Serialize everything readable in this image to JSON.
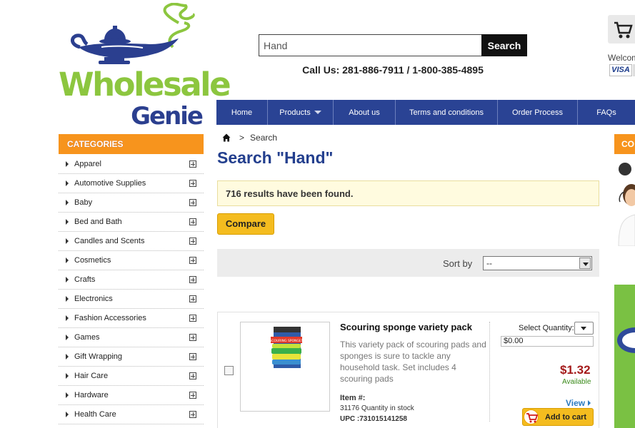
{
  "logo": {
    "line1": "Wholesale",
    "line2": "Genie"
  },
  "search": {
    "value": "Hand",
    "button_label": "Search"
  },
  "callus": "Call Us: 281-886-7911 / 1-800-385-4895",
  "header_right": {
    "welcome": "Welcom",
    "card": "VISA"
  },
  "nav": [
    {
      "label": "Home"
    },
    {
      "label": "Products",
      "dropdown": true
    },
    {
      "label": "About us"
    },
    {
      "label": "Terms and conditions"
    },
    {
      "label": "Order Process"
    },
    {
      "label": "FAQs"
    }
  ],
  "sidebar": {
    "heading": "CATEGORIES",
    "items": [
      "Apparel",
      "Automotive Supplies",
      "Baby",
      "Bed and Bath",
      "Candles and Scents",
      "Cosmetics",
      "Crafts",
      "Electronics",
      "Fashion Accessories",
      "Games",
      "Gift Wrapping",
      "Hair Care",
      "Hardware",
      "Health Care"
    ]
  },
  "breadcrumb": {
    "separator": ">",
    "current": "Search"
  },
  "page_title": "Search \"Hand\"",
  "results_text": "716 results have been found.",
  "compare_label": "Compare",
  "sort": {
    "label": "Sort by",
    "value": "--"
  },
  "product": {
    "title": "Scouring sponge variety pack",
    "description": "This variety pack of scouring pads and sponges is sure to tackle any household task. Set includes 4 scouring pads",
    "item_label": "Item #:",
    "stock": "31176 Quantity in stock",
    "upc": "UPC :731015141258",
    "qty_label": "Select Quantity:",
    "qty_total": "$0.00",
    "price": "$1.32",
    "availability": "Available",
    "view_label": "View",
    "add_to_cart_label": "Add to cart",
    "image_label": "SCOURING SPONGES"
  },
  "right_panel": {
    "heading": "CO"
  },
  "colors": {
    "nav": "#2a4394",
    "accent_orange": "#f7941d",
    "button_yellow": "#f4bc1f",
    "logo_green": "#8cc63f",
    "logo_blue": "#2b3f8f",
    "price_red": "#a41a1a"
  }
}
